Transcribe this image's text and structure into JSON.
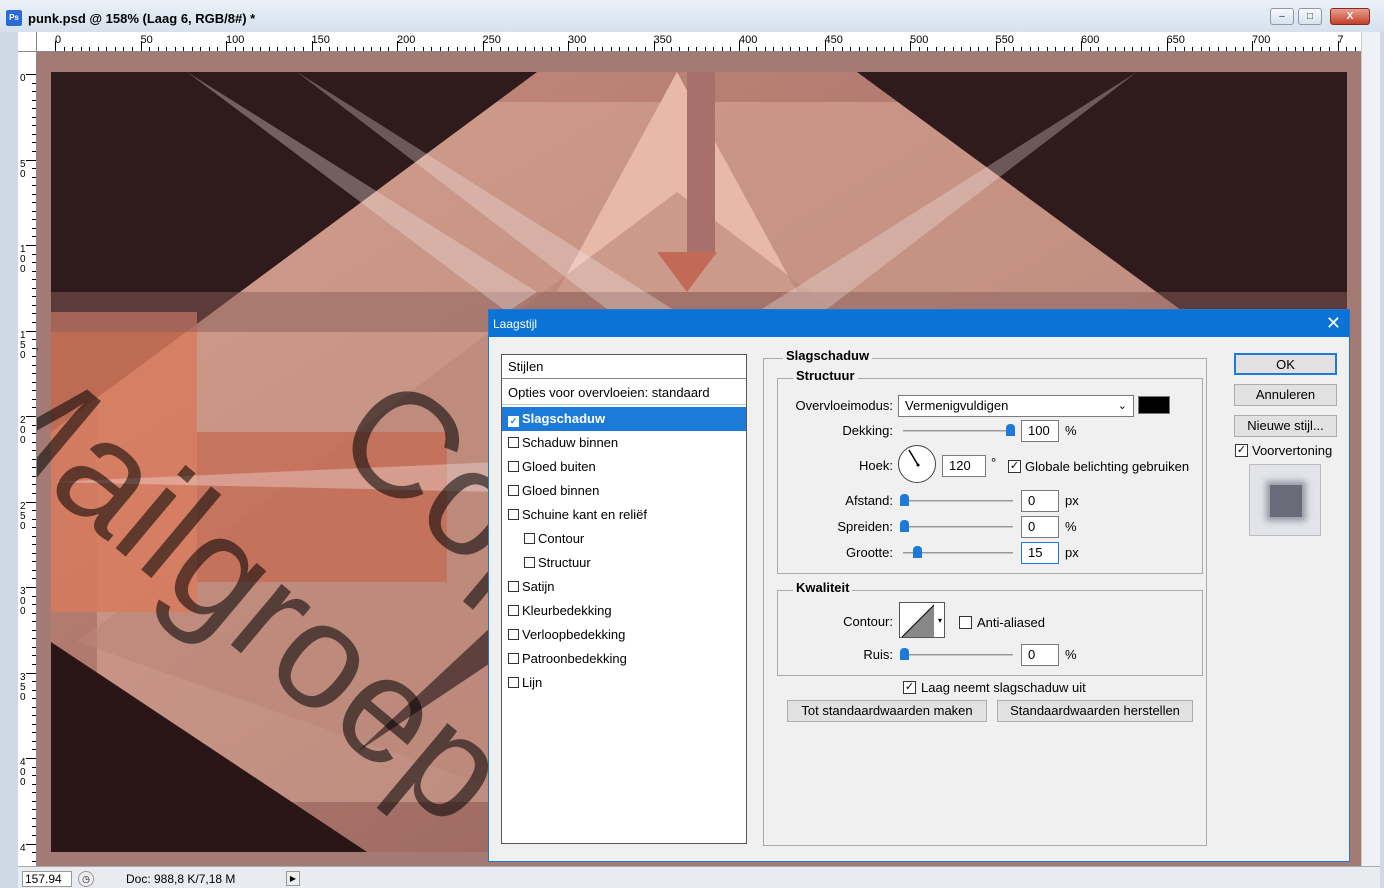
{
  "window": {
    "title": "punk.psd @ 158% (Laag 6, RGB/8#) *",
    "app_icon": "Ps",
    "controls": {
      "minimize": "–",
      "maximize": "□",
      "close": "X"
    }
  },
  "ruler": {
    "horizontal": [
      "0",
      "50",
      "100",
      "150",
      "200",
      "250",
      "300",
      "350",
      "400",
      "450",
      "500",
      "550",
      "600",
      "650",
      "700",
      "7"
    ],
    "vertical": [
      "0",
      "50",
      "100",
      "150",
      "200",
      "250",
      "300",
      "350",
      "400",
      "4"
    ]
  },
  "status": {
    "zoom": "157.94",
    "doc": "Doc: 988,8 K/7,18 M",
    "arrow": "▶"
  },
  "dialog": {
    "title": "Laagstijl",
    "close": "✕",
    "styles_header": "Stijlen",
    "blend_options": "Opties voor overvloeien: standaard",
    "styles": [
      {
        "label": "Slagschaduw",
        "checked": true,
        "selected": true,
        "indent": false
      },
      {
        "label": "Schaduw binnen",
        "checked": false,
        "indent": false
      },
      {
        "label": "Gloed buiten",
        "checked": false,
        "indent": false
      },
      {
        "label": "Gloed binnen",
        "checked": false,
        "indent": false
      },
      {
        "label": "Schuine kant en reliëf",
        "checked": false,
        "indent": false
      },
      {
        "label": "Contour",
        "checked": false,
        "indent": true
      },
      {
        "label": "Structuur",
        "checked": false,
        "indent": true
      },
      {
        "label": "Satijn",
        "checked": false,
        "indent": false
      },
      {
        "label": "Kleurbedekking",
        "checked": false,
        "indent": false
      },
      {
        "label": "Verloopbedekking",
        "checked": false,
        "indent": false
      },
      {
        "label": "Patroonbedekking",
        "checked": false,
        "indent": false
      },
      {
        "label": "Lijn",
        "checked": false,
        "indent": false
      }
    ],
    "section_title": "Slagschaduw",
    "structure": {
      "legend": "Structuur",
      "blend_mode_label": "Overvloeimodus:",
      "blend_mode_value": "Vermenigvuldigen",
      "shadow_color": "#000000",
      "opacity_label": "Dekking:",
      "opacity_value": "100",
      "opacity_unit": "%",
      "angle_label": "Hoek:",
      "angle_value": "120",
      "angle_unit": "°",
      "global_light_label": "Globale belichting gebruiken",
      "global_light_checked": true,
      "distance_label": "Afstand:",
      "distance_value": "0",
      "distance_unit": "px",
      "spread_label": "Spreiden:",
      "spread_value": "0",
      "spread_unit": "%",
      "size_label": "Grootte:",
      "size_value": "15",
      "size_unit": "px"
    },
    "quality": {
      "legend": "Kwaliteit",
      "contour_label": "Contour:",
      "antialiased_label": "Anti-aliased",
      "antialiased_checked": false,
      "noise_label": "Ruis:",
      "noise_value": "0",
      "noise_unit": "%"
    },
    "knockout_label": "Laag neemt slagschaduw uit",
    "knockout_checked": true,
    "make_default": "Tot standaardwaarden maken",
    "reset_default": "Standaardwaarden herstellen",
    "ok": "OK",
    "cancel": "Annuleren",
    "new_style": "Nieuwe stijl...",
    "preview_label": "Voorvertoning",
    "preview_checked": true
  },
  "watermark": [
    "Mailgroep",
    "Copyright"
  ]
}
